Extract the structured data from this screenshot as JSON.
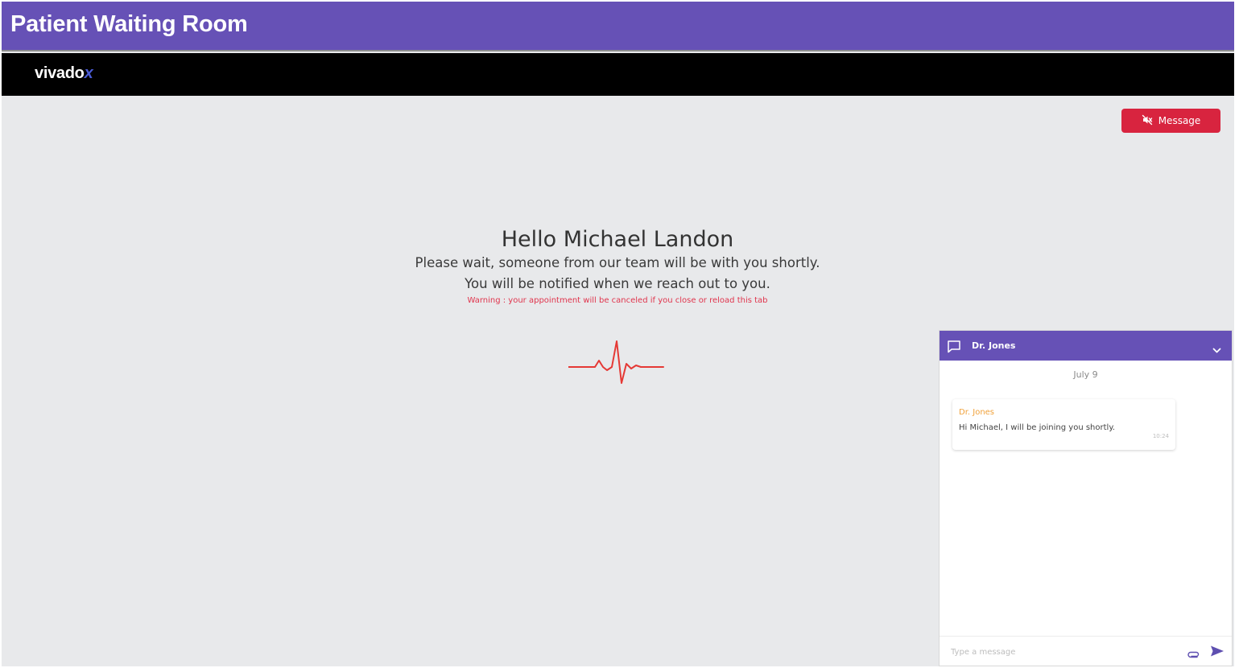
{
  "window": {
    "title": "Patient Waiting Room"
  },
  "brand": {
    "name_main": "vivado",
    "name_accent": "x"
  },
  "toolbar": {
    "message_label": "Message",
    "message_icon": "speaker-muted-icon"
  },
  "welcome": {
    "greeting": "Hello Michael Landon",
    "line1": "Please wait, someone from our team will be with you shortly.",
    "line2": "You will be notified when we reach out to you.",
    "warning": "Warning : your appointment will be canceled if you close or reload this tab"
  },
  "chat": {
    "title": "Dr. Jones",
    "date": "July 9",
    "messages": [
      {
        "author": "Dr. Jones",
        "text": "Hi Michael, I will be joining you shortly.",
        "time": "10:24"
      }
    ],
    "input_placeholder": "Type a message"
  },
  "colors": {
    "header": "#6651b6",
    "nav": "#000000",
    "accent_red": "#d8243f",
    "background": "#e8e9eb",
    "author": "#f0a13a"
  }
}
